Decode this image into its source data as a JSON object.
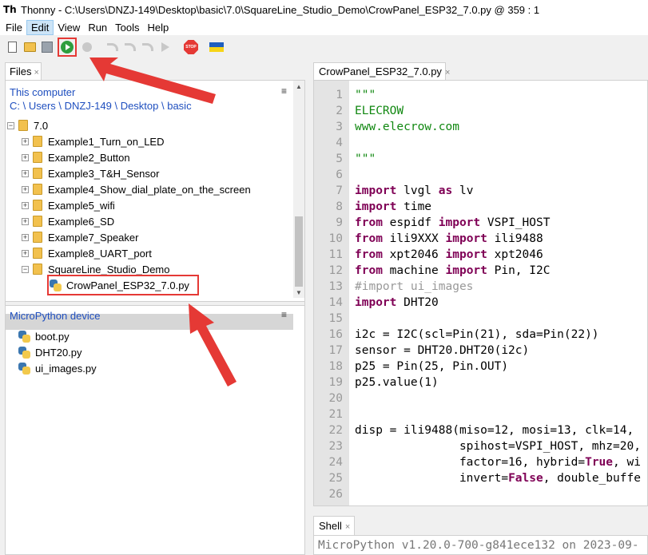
{
  "window": {
    "app_logo": "Th",
    "title": "Thonny  -  C:\\Users\\DNZJ-149\\Desktop\\basic\\7.0\\SquareLine_Studio_Demo\\CrowPanel_ESP32_7.0.py  @  359 : 1"
  },
  "menu": [
    "File",
    "Edit",
    "View",
    "Run",
    "Tools",
    "Help"
  ],
  "toolbar": {
    "icons": [
      "new-file-icon",
      "open-folder-icon",
      "save-icon",
      "run-icon",
      "debug-icon",
      "step-over-icon",
      "step-into-icon",
      "step-out-icon",
      "resume-icon",
      "stop-icon",
      "ukraine-flag-icon"
    ],
    "stop_label": "STOP"
  },
  "files_panel": {
    "tab_label": "Files",
    "close_glyph": "×",
    "menu_glyph": "≡",
    "this_computer": "This computer",
    "path": "C: \\ Users \\ DNZJ-149 \\ Desktop \\ basic",
    "tree": [
      {
        "label": "7.0",
        "expander": "−"
      },
      {
        "label": "Example1_Turn_on_LED",
        "expander": "+"
      },
      {
        "label": "Example2_Button",
        "expander": "+"
      },
      {
        "label": "Example3_T&H_Sensor",
        "expander": "+"
      },
      {
        "label": "Example4_Show_dial_plate_on_the_screen",
        "expander": "+"
      },
      {
        "label": "Example5_wifi",
        "expander": "+"
      },
      {
        "label": "Example6_SD",
        "expander": "+"
      },
      {
        "label": "Example7_Speaker",
        "expander": "+"
      },
      {
        "label": "Example8_UART_port",
        "expander": "+"
      },
      {
        "label": "SquareLine_Studio_Demo",
        "expander": "−"
      },
      {
        "label": "CrowPanel_ESP32_7.0.py"
      }
    ],
    "device_title": "MicroPython device",
    "device_files": [
      "boot.py",
      "DHT20.py",
      "ui_images.py"
    ]
  },
  "editor": {
    "tab_label": "CrowPanel_ESP32_7.0.py",
    "close_glyph": "×",
    "lines": [
      "\"\"\"",
      "ELECROW",
      "www.elecrow.com",
      "",
      "\"\"\"",
      "",
      "import lvgl as lv",
      "import time",
      "from espidf import VSPI_HOST",
      "from ili9XXX import ili9488",
      "from xpt2046 import xpt2046",
      "from machine import Pin, I2C",
      "#import ui_images",
      "import DHT20",
      "",
      "i2c = I2C(scl=Pin(21), sda=Pin(22))",
      "sensor = DHT20.DHT20(i2c)",
      "p25 = Pin(25, Pin.OUT)",
      "p25.value(1)",
      "",
      "",
      "disp = ili9488(miso=12, mosi=13, clk=14,",
      "               spihost=VSPI_HOST, mhz=20,",
      "               factor=16, hybrid=True, wi",
      "               invert=False, double_buffe",
      ""
    ]
  },
  "shell": {
    "tab_label": "Shell",
    "close_glyph": "×",
    "text": "MicroPython v1.20.0-700-g841ece132 on 2023-09-"
  },
  "colors": {
    "keyword": "#7f0055",
    "string": "#118811",
    "comment": "#999999",
    "link_blue": "#1f4fbf",
    "annotation_red": "#e53935"
  }
}
